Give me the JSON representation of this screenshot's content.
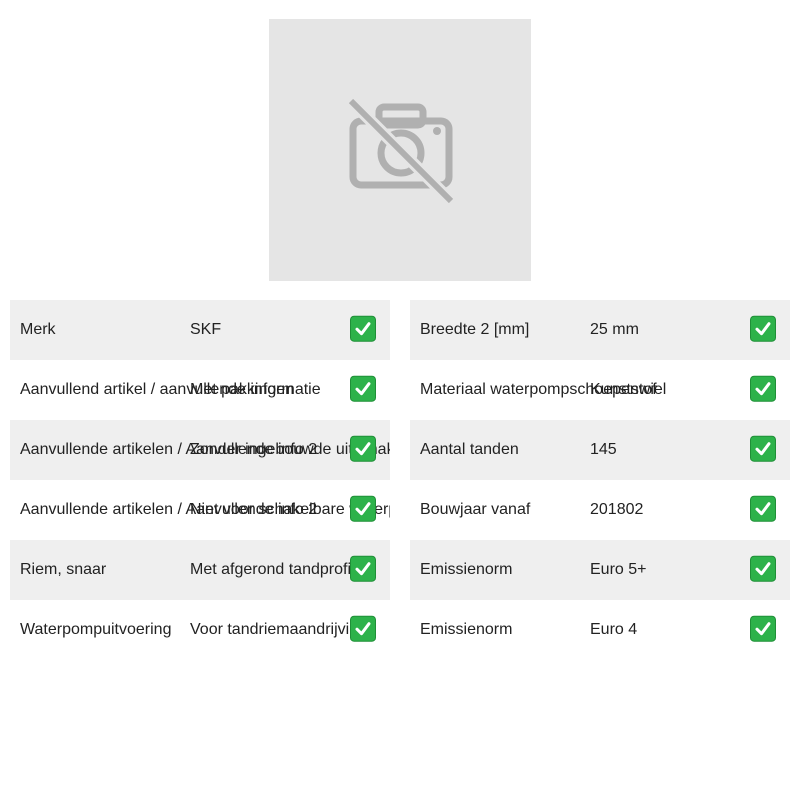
{
  "image": {
    "icon": "no-photo-icon"
  },
  "left_table": [
    {
      "label": "Merk",
      "value": "SKF",
      "icon": "check-icon"
    },
    {
      "label": "Aanvullend artikel / aanvullende informatie",
      "value": "Met pakkingen",
      "icon": "check-icon"
    },
    {
      "label": "Aanvullende artikelen / Aanvullende info 2",
      "value": "Zonder ingebouwde uitschakeling",
      "icon": "check-icon"
    },
    {
      "label": "Aanvullende artikelen / Aanvullende info 2",
      "value": "Niet voor schakelbare waterpomp",
      "icon": "check-icon"
    },
    {
      "label": "Riem, snaar",
      "value": "Met afgerond tandprofiel",
      "icon": "check-icon"
    },
    {
      "label": "Waterpompuitvoering",
      "value": "Voor tandriemaandrijving",
      "icon": "check-icon"
    }
  ],
  "right_table": [
    {
      "label": "Breedte 2 [mm]",
      "value": "25 mm",
      "icon": "check-icon"
    },
    {
      "label": "Materiaal waterpompschoepenwiel",
      "value": "Kunststof",
      "icon": "check-icon"
    },
    {
      "label": "Aantal tanden",
      "value": "145",
      "icon": "check-icon"
    },
    {
      "label": "Bouwjaar vanaf",
      "value": "201802",
      "icon": "check-icon"
    },
    {
      "label": "Emissienorm",
      "value": "Euro 5+",
      "icon": "check-icon"
    },
    {
      "label": "Emissienorm",
      "value": "Euro 4",
      "icon": "check-icon"
    }
  ]
}
